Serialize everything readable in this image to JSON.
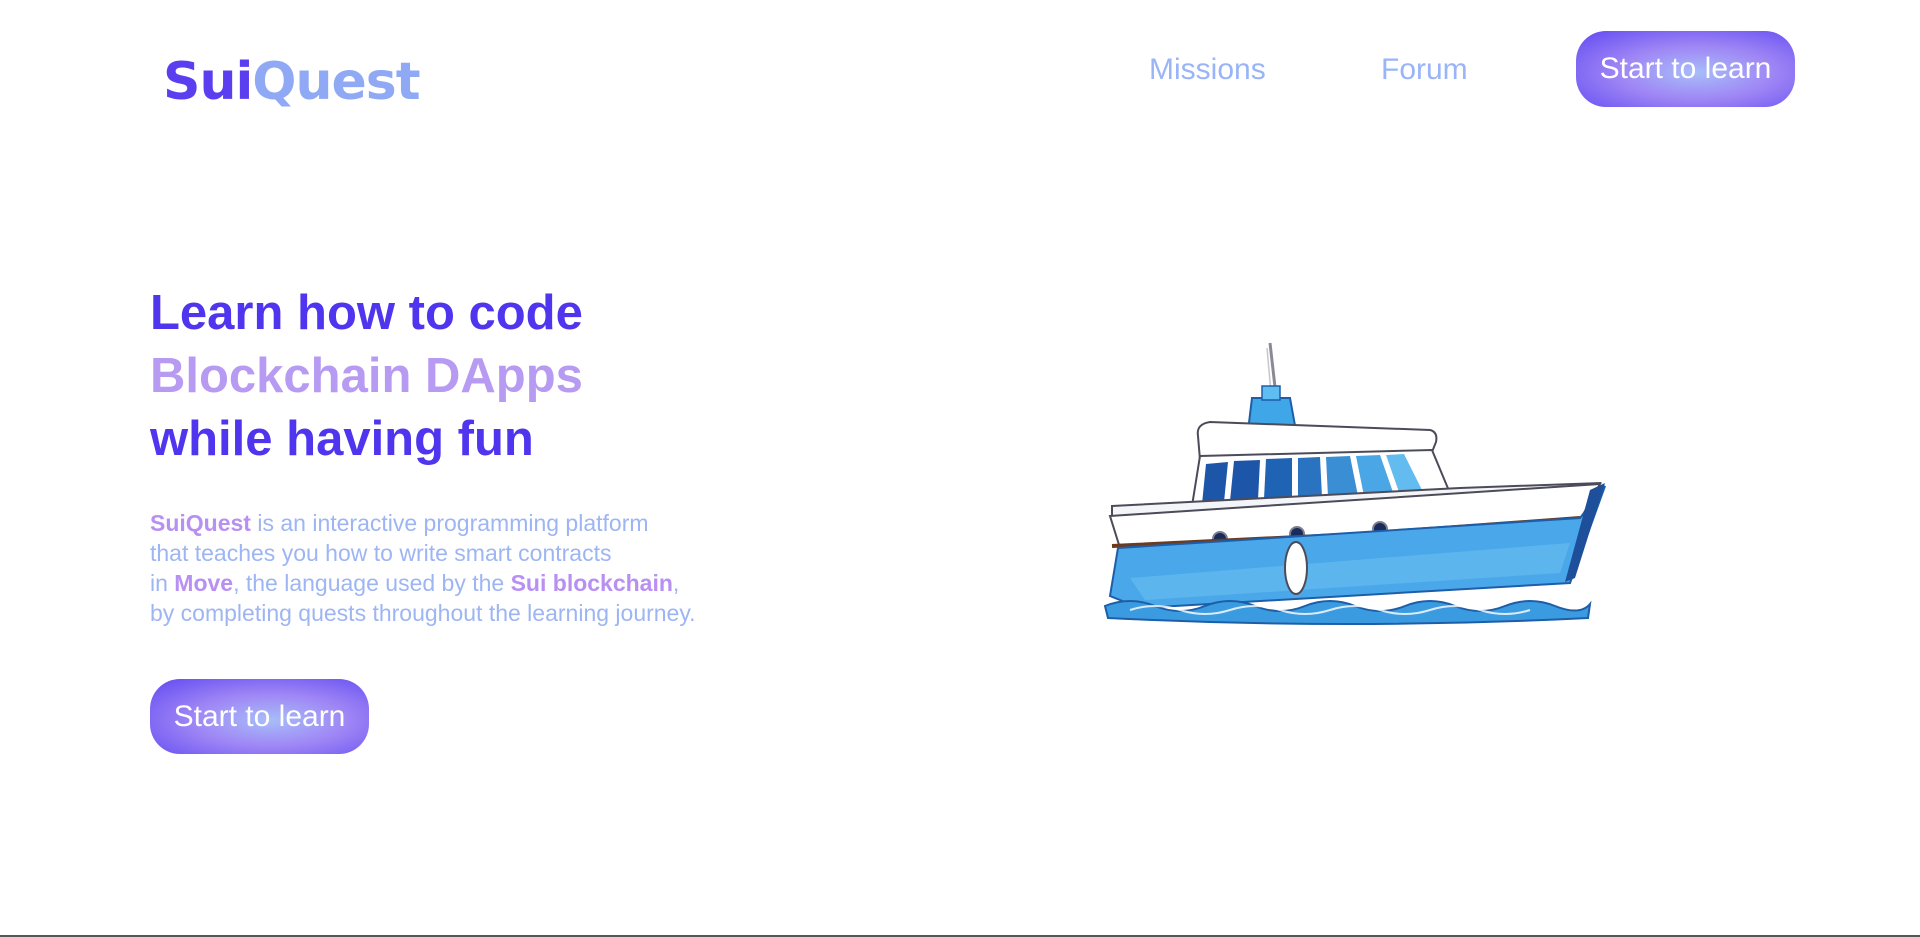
{
  "logo": {
    "part1": "Sui",
    "part2": "Quest"
  },
  "nav": {
    "missions": "Missions",
    "forum": "Forum",
    "cta": "Start to learn"
  },
  "hero": {
    "line1": "Learn how to code",
    "line2": "Blockchain DApps",
    "line3": "while having fun",
    "desc": {
      "brand": "SuiQuest",
      "t1": " is an interactive programming platform",
      "t2": "that teaches you how to write smart contracts",
      "t3": "in ",
      "move": "Move",
      "t4": ", the language used by the ",
      "sui": "Sui blockchain",
      "t5": ",",
      "t6": "by completing quests throughout the learning journey."
    },
    "cta": "Start to learn"
  },
  "colors": {
    "primary": "#4f36ee",
    "secondary": "#b79af2",
    "link": "#99b4f7",
    "boat_hull": "#4aa8ea"
  },
  "icons": {
    "hero_image": "boat-illustration"
  }
}
